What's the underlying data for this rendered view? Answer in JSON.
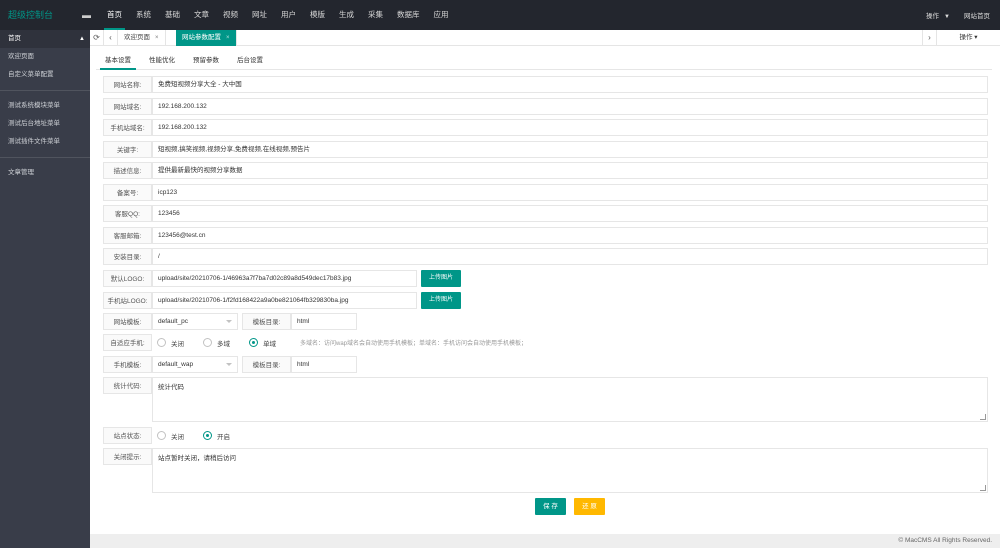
{
  "app": {
    "title": "超级控制台",
    "toggle": "▬"
  },
  "topnav": {
    "items": [
      "首页",
      "系统",
      "基础",
      "文章",
      "视频",
      "网址",
      "用户",
      "模版",
      "生成",
      "采集",
      "数据库",
      "应用"
    ],
    "active_index": 0,
    "ops_label": "操作",
    "home_link": "网站首页"
  },
  "sidebar": {
    "items": [
      "首页",
      "欢迎页面",
      "自定义菜单配置",
      "测试系统模块菜单",
      "测试后台地址菜单",
      "测试插件文件菜单",
      "文章管理"
    ]
  },
  "tabsbar": {
    "refresh_icon": "refresh-icon",
    "tabs": [
      {
        "label": "欢迎页面",
        "close": "×"
      },
      {
        "label": "网站参数配置",
        "close": "×"
      }
    ],
    "ops_label": "操作"
  },
  "content_tabs": [
    "基本设置",
    "性能优化",
    "预留参数",
    "后台设置"
  ],
  "form": {
    "site_name": {
      "label": "网站名称:",
      "value": "免费短视频分享大全 - 大中国"
    },
    "site_domain": {
      "label": "网站域名:",
      "value": "192.168.200.132"
    },
    "mobile_domain": {
      "label": "手机站域名:",
      "value": "192.168.200.132"
    },
    "keywords": {
      "label": "关键字:",
      "value": "短视频,搞笑视频,视频分享,免费视频,在线视频,预告片"
    },
    "description": {
      "label": "描述信息:",
      "value": "提供最新最快的视频分享数据"
    },
    "icp": {
      "label": "备案号:",
      "value": "icp123"
    },
    "qq": {
      "label": "客服QQ:",
      "value": "123456"
    },
    "email": {
      "label": "客服邮箱:",
      "value": "123456@test.cn"
    },
    "install_dir": {
      "label": "安装目录:",
      "value": "/"
    },
    "logo": {
      "label": "默认LOGO:",
      "value": "upload/site/20210706-1/46963a7f7ba7d02c89a8d549dec17b83.jpg",
      "button": "上传图片"
    },
    "mobile_logo": {
      "label": "手机站LOGO:",
      "value": "upload/site/20210706-1/f2fd168422a9a0be821064fb329830ba.jpg",
      "button": "上传图片"
    },
    "site_template": {
      "label": "网站模板:",
      "value": "default_pc",
      "dir_label": "模板目录:",
      "dir_value": "html"
    },
    "adaptive": {
      "label": "自适应手机:",
      "options": [
        "关闭",
        "多域",
        "单域"
      ],
      "selected": 2,
      "hint": "多域名：访问wap域名会自动使用手机模板；单域名：手机访问会自动使用手机模板；"
    },
    "mobile_template": {
      "label": "手机模板:",
      "value": "default_wap",
      "dir_label": "模板目录:",
      "dir_value": "html"
    },
    "stats_code": {
      "label": "统计代码:",
      "value": "统计代码"
    },
    "site_status": {
      "label": "站点状态:",
      "options": [
        "关闭",
        "开启"
      ],
      "selected": 1
    },
    "close_tip": {
      "label": "关闭提示:",
      "value": "站点暂时关闭，请稍后访问"
    }
  },
  "actions": {
    "save": "保 存",
    "reset": "还 原"
  },
  "footer": {
    "text": "© MacCMS All Rights Reserved."
  },
  "colors": {
    "accent": "#009688",
    "warning": "#ffb800",
    "topbar": "#23262e",
    "sidebar": "#393d49"
  }
}
